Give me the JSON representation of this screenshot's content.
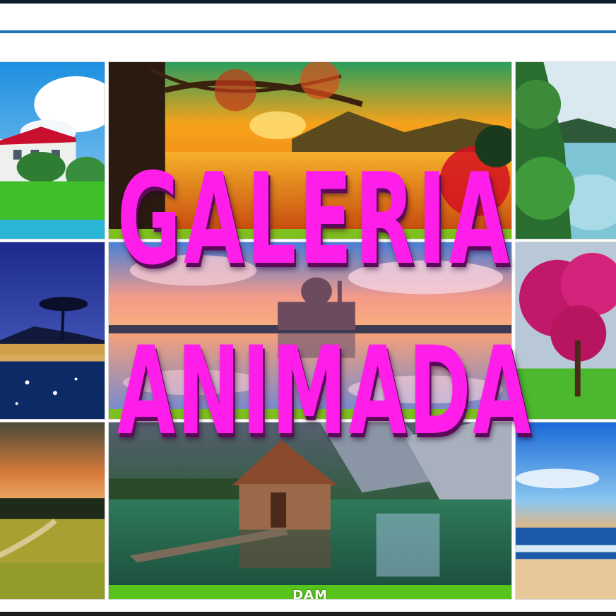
{
  "headline": {
    "line1": "GALERIA",
    "line2": "ANIMADA",
    "color": "#ff1ee9"
  },
  "gallery": {
    "tiles": [
      {
        "name": "house-by-lake",
        "caption": ""
      },
      {
        "name": "autumn-sunset-lake",
        "caption": ""
      },
      {
        "name": "lake-green-trees",
        "caption": ""
      },
      {
        "name": "night-resort-pool",
        "caption": ""
      },
      {
        "name": "mosque-sunset-reflection",
        "caption": ""
      },
      {
        "name": "pink-blossom-tree",
        "caption": ""
      },
      {
        "name": "country-path-sunset",
        "caption": ""
      },
      {
        "name": "boathouse-mountain-lake",
        "caption": "DAM"
      },
      {
        "name": "beach-sunset",
        "caption": ""
      }
    ]
  },
  "colors": {
    "top_bar": "#0d1b2a",
    "accent_line": "#1a73b8",
    "caption_bar": "#56c41a"
  }
}
